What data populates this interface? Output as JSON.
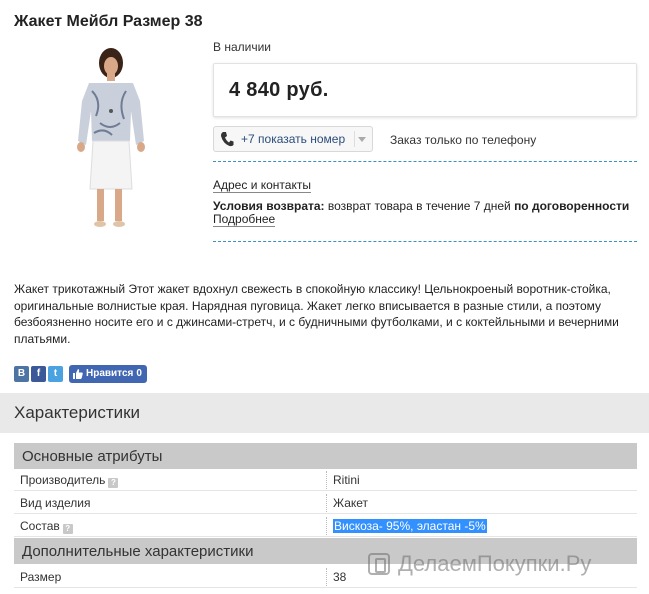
{
  "product": {
    "title": "Жакет Мейбл Размер 38",
    "availability": "В наличии",
    "price": "4 840 руб."
  },
  "contact": {
    "phone_label": "+7 показать номер",
    "order_note": "Заказ только по телефону",
    "address_link": "Адрес и контакты",
    "return_label": "Условия возврата:",
    "return_text": " возврат товара в течение 7 дней ",
    "return_bold": "по договоренности",
    "more_link": "Подробнее"
  },
  "description": "Жакет трикотажный Этот жакет вдохнул свежесть в спокойную классику! Цельнокроеный воротник-стойка, оригинальные волнистые края. Нарядная пуговица. Жакет легко вписывается в разные стили, а поэтому безбоязненно носите его и с джинсами-стретч, и с будничными футболками, и с коктейльными и вечерними платьями.",
  "social": {
    "vk": "В",
    "fb": "f",
    "tw": "t",
    "like_label": "Нравится",
    "like_count": "0"
  },
  "specs": {
    "title": "Характеристики",
    "groups": [
      {
        "title": "Основные атрибуты",
        "rows": [
          {
            "label": "Производитель",
            "value": "Ritini",
            "help": true
          },
          {
            "label": "Вид изделия",
            "value": "Жакет",
            "help": false
          },
          {
            "label": "Состав",
            "value": "Вискоза- 95%, эластан -5%",
            "help": true,
            "selected": true
          }
        ]
      },
      {
        "title": "Дополнительные характеристики",
        "rows": [
          {
            "label": "Размер",
            "value": "38",
            "help": false
          }
        ]
      }
    ]
  },
  "watermark": "ДелаемПокупки.Ру",
  "colors": {
    "link": "#2a4d7a",
    "dashed_divider": "#3b8fc2",
    "selection": "#3390ff",
    "vk": "#4c75a3",
    "facebook": "#3b5998",
    "twitter": "#4aa3e0"
  },
  "icons": [
    "phone-icon",
    "chevron-down-icon",
    "help-icon",
    "vk-icon",
    "facebook-icon",
    "twitter-icon",
    "thumbs-up-icon",
    "watermark-logo-icon"
  ]
}
